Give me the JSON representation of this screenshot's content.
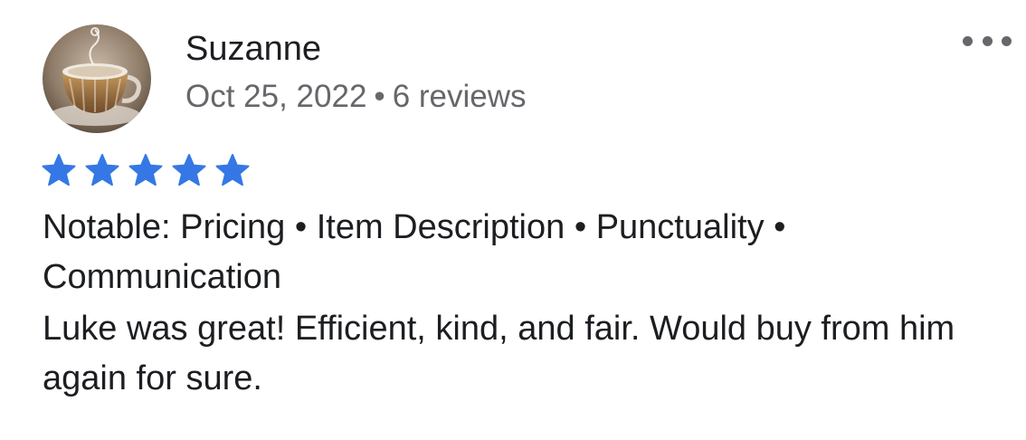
{
  "review": {
    "reviewer_name": "Suzanne",
    "date": "Oct 25, 2022",
    "separator": "•",
    "review_count": "6 reviews",
    "rating": 5,
    "rating_max": 5,
    "star_color": "#3578e5",
    "notable_prefix": "Notable:",
    "notable_tags": [
      "Pricing",
      "Item Description",
      "Punctuality",
      "Communication"
    ],
    "text": "Luke was great! Efficient, kind, and fair. Would buy from him again for sure."
  },
  "icons": {
    "more": "more-horizontal-icon",
    "star": "star-icon",
    "avatar": "teacup-photo"
  }
}
